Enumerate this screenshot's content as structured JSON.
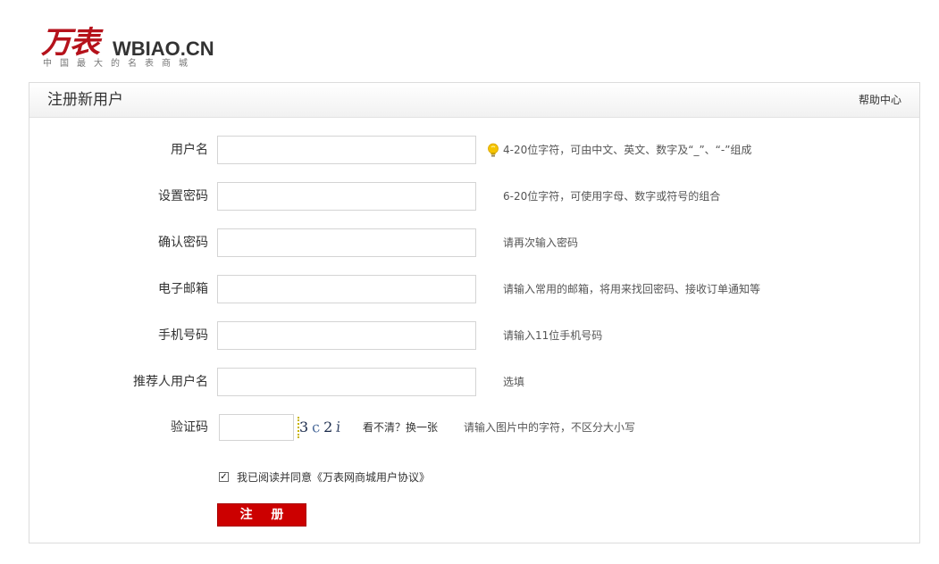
{
  "logo": {
    "cn": "万表",
    "en": "WBIAO.CN",
    "tagline": "中国最大的名表商城"
  },
  "panel": {
    "title": "注册新用户",
    "help": "帮助中心"
  },
  "form": {
    "fields": [
      {
        "label": "用户名",
        "value": "",
        "tip": "4-20位字符，可由中文、英文、数字及“_”、“-”组成"
      },
      {
        "label": "设置密码",
        "value": "",
        "tip": "6-20位字符，可使用字母、数字或符号的组合"
      },
      {
        "label": "确认密码",
        "value": "",
        "tip": "请再次输入密码"
      },
      {
        "label": "电子邮箱",
        "value": "",
        "tip": "请输入常用的邮箱，将用来找回密码、接收订单通知等"
      },
      {
        "label": "手机号码",
        "value": "",
        "tip": "请输入11位手机号码"
      },
      {
        "label": "推荐人用户名",
        "value": "",
        "tip": "选填"
      }
    ],
    "captcha": {
      "label": "验证码",
      "value": "",
      "chars": [
        "3",
        "c",
        "2",
        "i"
      ],
      "refresh": "看不清？换一张",
      "tip": "请输入图片中的字符，不区分大小写"
    },
    "agreement": {
      "checked": true,
      "text": "我已阅读并同意《万表网商城用户协议》"
    },
    "submit_label": "注 册"
  },
  "colors": {
    "brand_red": "#b5121b",
    "button_red": "#cc0000",
    "bulb_yellow": "#f5c400"
  }
}
